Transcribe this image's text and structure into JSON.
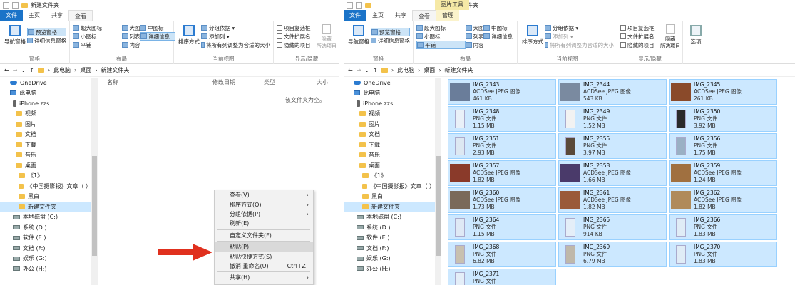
{
  "left": {
    "title": "新建文件夹",
    "tabs": [
      "文件",
      "主页",
      "共享",
      "查看"
    ],
    "nav_pane": [
      "导航窗格"
    ],
    "panes": [
      "预览窗格",
      "详细信息窗格"
    ],
    "layout": [
      "超大图标",
      "大图标",
      "中图标",
      "小图标",
      "列表",
      "详细信息",
      "平铺",
      "内容"
    ],
    "sort": "排序方式",
    "view_opts": [
      "分组依据 ▾",
      "添加列 ▾",
      "将所有列调整为合适的大小"
    ],
    "show": [
      "项目复选框",
      "文件扩展名",
      "隐藏的项目"
    ],
    "hide": "隐藏\n所选项目",
    "groups": [
      "窗格",
      "布局",
      "当前视图",
      "显示/隐藏"
    ],
    "path": [
      "此电脑",
      "桌面",
      "新建文件夹"
    ],
    "columns": [
      "名称",
      "修改日期",
      "类型",
      "大小"
    ],
    "empty": "该文件夹为空。"
  },
  "right": {
    "title": "新建文件夹",
    "context_tab": "图片工具",
    "tabs": [
      "文件",
      "主页",
      "共享",
      "查看",
      "管理"
    ],
    "options": "选项"
  },
  "nav_items": [
    {
      "label": "OneDrive",
      "icon": "cloud-icon"
    },
    {
      "label": "此电脑",
      "icon": "computer-icon"
    },
    {
      "label": "iPhone zzs",
      "icon": "phone-icon"
    },
    {
      "label": "视频",
      "icon": "folder-icon"
    },
    {
      "label": "图片",
      "icon": "folder-icon"
    },
    {
      "label": "文档",
      "icon": "folder-icon"
    },
    {
      "label": "下载",
      "icon": "folder-icon"
    },
    {
      "label": "音乐",
      "icon": "folder-icon"
    },
    {
      "label": "桌面",
      "icon": "folder-icon"
    },
    {
      "label": "《1》",
      "icon": "folder-icon"
    },
    {
      "label": "《中国摄影报》文章（ ）",
      "icon": "folder-icon"
    },
    {
      "label": "黑白",
      "icon": "folder-icon"
    },
    {
      "label": "新建文件夹",
      "icon": "folder-icon"
    },
    {
      "label": "本地磁盘 (C:)",
      "icon": "drive-icon"
    },
    {
      "label": "系统 (D:)",
      "icon": "drive-icon"
    },
    {
      "label": "软件 (E:)",
      "icon": "drive-icon"
    },
    {
      "label": "文档 (F:)",
      "icon": "drive-icon"
    },
    {
      "label": "娱乐 (G:)",
      "icon": "drive-icon"
    },
    {
      "label": "办公 (H:)",
      "icon": "drive-icon"
    }
  ],
  "context_menu": [
    {
      "label": "查看(V)",
      "arrow": "›"
    },
    {
      "label": "排序方式(O)",
      "arrow": "›"
    },
    {
      "label": "分组依据(P)",
      "arrow": "›"
    },
    {
      "label": "刷新(E)"
    },
    {
      "sep": true
    },
    {
      "label": "自定义文件夹(F)..."
    },
    {
      "sep": true
    },
    {
      "label": "粘贴(P)",
      "highlight": true
    },
    {
      "label": "粘贴快捷方式(S)"
    },
    {
      "label": "撤消 重命名(U)",
      "shortcut": "Ctrl+Z"
    },
    {
      "sep": true
    },
    {
      "label": "共享(H)",
      "arrow": "›"
    }
  ],
  "files": [
    {
      "name": "IMG_2343",
      "type": "ACDSee JPEG 图像",
      "size": "461 KB",
      "thumb": "#6a7d9a"
    },
    {
      "name": "IMG_2344",
      "type": "ACDSee JPEG 图像",
      "size": "543 KB",
      "thumb": "#7a8aa0"
    },
    {
      "name": "IMG_2345",
      "type": "ACDSee JPEG 图像",
      "size": "261 KB",
      "thumb": "#8a4a2a"
    },
    {
      "name": "IMG_2348",
      "type": "PNG 文件",
      "size": "1.15 MB",
      "thumb": "#e9f0f8"
    },
    {
      "name": "IMG_2349",
      "type": "PNG 文件",
      "size": "1.52 MB",
      "thumb": "#f2f2f2"
    },
    {
      "name": "IMG_2350",
      "type": "PNG 文件",
      "size": "3.92 MB",
      "thumb": "#2a2a2a"
    },
    {
      "name": "IMG_2351",
      "type": "PNG 文件",
      "size": "2.93 MB",
      "thumb": "#dde8f2"
    },
    {
      "name": "IMG_2355",
      "type": "PNG 文件",
      "size": "3.97 MB",
      "thumb": "#5a4a3a"
    },
    {
      "name": "IMG_2356",
      "type": "PNG 文件",
      "size": "1.75 MB",
      "thumb": "#9ab0c4"
    },
    {
      "name": "IMG_2357",
      "type": "ACDSee JPEG 图像",
      "size": "1.82 MB",
      "thumb": "#8a3a2a"
    },
    {
      "name": "IMG_2358",
      "type": "ACDSee JPEG 图像",
      "size": "1.66 MB",
      "thumb": "#4a3a6a"
    },
    {
      "name": "IMG_2359",
      "type": "ACDSee JPEG 图像",
      "size": "1.24 MB",
      "thumb": "#a07040"
    },
    {
      "name": "IMG_2360",
      "type": "ACDSee JPEG 图像",
      "size": "1.73 MB",
      "thumb": "#7a6a5a"
    },
    {
      "name": "IMG_2361",
      "type": "ACDSee JPEG 图像",
      "size": "1.82 MB",
      "thumb": "#9a5a3a"
    },
    {
      "name": "IMG_2362",
      "type": "ACDSee JPEG 图像",
      "size": "1.82 MB",
      "thumb": "#b08a5a"
    },
    {
      "name": "IMG_2364",
      "type": "PNG 文件",
      "size": "1.15 MB",
      "thumb": "#dfe9f5"
    },
    {
      "name": "IMG_2365",
      "type": "PNG 文件",
      "size": "914 KB",
      "thumb": "#e4eef8"
    },
    {
      "name": "IMG_2366",
      "type": "PNG 文件",
      "size": "1.83 MB",
      "thumb": "#e0ecf6"
    },
    {
      "name": "IMG_2368",
      "type": "PNG 文件",
      "size": "6.82 MB",
      "thumb": "#c8c0b0"
    },
    {
      "name": "IMG_2369",
      "type": "PNG 文件",
      "size": "6.79 MB",
      "thumb": "#bfb8aa"
    },
    {
      "name": "IMG_2370",
      "type": "PNG 文件",
      "size": "1.83 MB",
      "thumb": "#e0ecf6"
    },
    {
      "name": "IMG_2371",
      "type": "PNG 文件",
      "size": "",
      "thumb": "#e4eef8"
    }
  ],
  "colors": {
    "accent": "#1a73c8",
    "selection": "#cce8ff",
    "context_tab": "#f6e9a6",
    "arrow": "#e0301e"
  }
}
